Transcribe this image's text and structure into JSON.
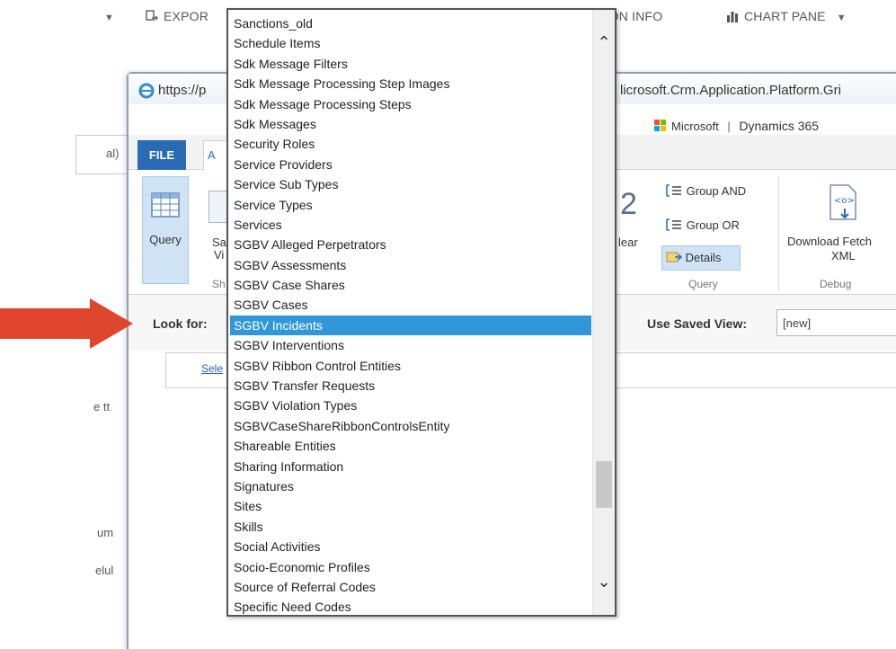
{
  "toolbar": {
    "items": [
      {
        "label": "EXPOR",
        "icon": "export-icon"
      },
      {
        "label": "SION INFO",
        "icon": "info-icon"
      },
      {
        "label": "CHART PANE",
        "icon": "chart-icon"
      }
    ]
  },
  "left_panel": {
    "fragments": [
      "al)",
      "e tt",
      "um",
      "elul"
    ]
  },
  "window": {
    "url_left": "https://p",
    "url_right": "licrosoft.Crm.Application.Platform.Gri",
    "brand": "Microsoft",
    "product": "Dynamics 365",
    "ribbon": {
      "file_tab": "FILE",
      "tab2_letter": "A",
      "query_label": "Query",
      "saved_view_line1": "Sa",
      "saved_view_line2": "Vi",
      "group_left_label": "Sh",
      "clear_label": "lear",
      "group_and": "Group AND",
      "group_or": "Group OR",
      "details": "Details",
      "query_group_label": "Query",
      "download_fetch": "Download Fetch",
      "download_xml": "XML",
      "debug_label": "Debug"
    },
    "look_for_label": "Look for:",
    "use_saved_view_label": "Use Saved View:",
    "saved_view_value": "[new]",
    "select_link": "Sele"
  },
  "dropdown": {
    "items": [
      "Sanctions_old",
      "Schedule Items",
      "Sdk Message Filters",
      "Sdk Message Processing Step Images",
      "Sdk Message Processing Steps",
      "Sdk Messages",
      "Security Roles",
      "Service Providers",
      "Service Sub Types",
      "Service Types",
      "Services",
      "SGBV Alleged Perpetrators",
      "SGBV Assessments",
      "SGBV Case Shares",
      "SGBV Cases",
      "SGBV Incidents",
      "SGBV Interventions",
      "SGBV Ribbon Control Entities",
      "SGBV Transfer Requests",
      "SGBV Violation Types",
      "SGBVCaseShareRibbonControlsEntity",
      "Shareable Entities",
      "Sharing Information",
      "Signatures",
      "Sites",
      "Skills",
      "Social Activities",
      "Socio-Economic Profiles",
      "Source of Referral Codes",
      "Specific Need Codes"
    ],
    "selected": "SGBV Incidents"
  },
  "colors": {
    "arrow": "#e0452e",
    "selection": "#3197d6",
    "file_tab": "#2b6bb5"
  }
}
